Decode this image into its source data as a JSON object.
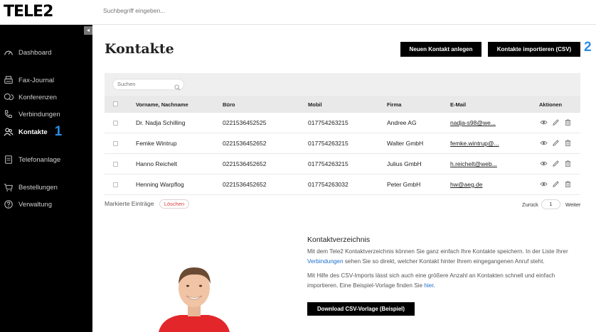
{
  "app": {
    "logo": "TELE2"
  },
  "search": {
    "placeholder": "Suchbegriff eingeben..."
  },
  "sidebar": {
    "collapse_glyph": "◂",
    "items": [
      {
        "label": "Dashboard",
        "icon": "gauge-icon"
      },
      {
        "label": "Fax-Journal",
        "icon": "fax-icon"
      },
      {
        "label": "Konferenzen",
        "icon": "chat-icon"
      },
      {
        "label": "Verbindungen",
        "icon": "phone-icon"
      },
      {
        "label": "Kontakte",
        "icon": "users-icon",
        "active": true,
        "step": "1"
      },
      {
        "label": "Telefonanlage",
        "icon": "pbx-icon"
      },
      {
        "label": "Bestellungen",
        "icon": "cart-icon"
      },
      {
        "label": "Verwaltung",
        "icon": "help-icon"
      }
    ]
  },
  "page": {
    "title": "Kontakte",
    "new_button": "Neuen Kontakt anlegen",
    "import_button": "Kontakte importieren (CSV)",
    "import_step": "2"
  },
  "table": {
    "search_placeholder": "Suchen",
    "columns": [
      "Vorname, Nachname",
      "Büro",
      "Mobil",
      "Firma",
      "E-Mail",
      "Aktionen"
    ],
    "rows": [
      {
        "name": "Dr. Nadja Schilling",
        "office": "0221536452525",
        "mobile": "017754263215",
        "company": "Andree AG",
        "email": "nadja-s98@we..."
      },
      {
        "name": "Femke Wintrup",
        "office": "0221536452652",
        "mobile": "017754263215",
        "company": "Walter GmbH",
        "email": "femke.wintrup@..."
      },
      {
        "name": "Hanno Reichelt",
        "office": "0221536452652",
        "mobile": "017754263215",
        "company": "Julius GmbH",
        "email": "h.reichelt@web..."
      },
      {
        "name": "Henning Warpflog",
        "office": "0221536452652",
        "mobile": "017754263032",
        "company": "Peter GmbH",
        "email": "hw@aeg.de"
      }
    ],
    "marked_label": "Markierte Einträge",
    "delete_label": "Löschen",
    "pager": {
      "back": "Zurück",
      "page": "1",
      "next": "Weiter"
    }
  },
  "info": {
    "title": "Kontaktverzeichnis",
    "p1_before": "Mit dem Tele2 Kontaktverzeichnis können Sie ganz einfach Ihre Kontakte speichern. In der Liste Ihrer",
    "p1_link": "Verbindungen",
    "p1_after": " sehen Sie so direkt, welcher Kontakt hinter Ihrem eingegangenen Anruf steht.",
    "p2_before": "Mit Hilfe des CSV-Imports lässt sich auch eine größere Anzahl an Kontakten schnell und einfach importieren. Eine Beispiel-Vorlage finden Sie ",
    "p2_link": "hier",
    "p2_after": ".",
    "download_button": "Download CSV-Vorlage (Beispiel)"
  },
  "colors": {
    "accent": "#2a8de8",
    "sidebar": "#000000",
    "link": "#1d6fcc",
    "delete": "#d94040",
    "shirt": "#e3262a"
  }
}
